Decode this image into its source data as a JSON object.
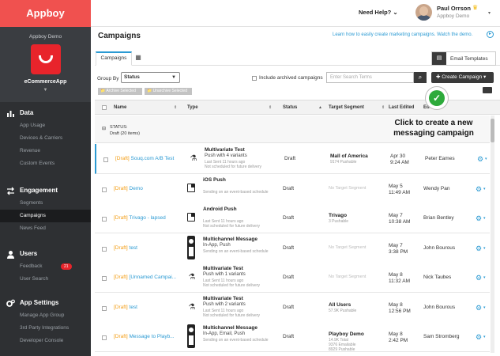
{
  "brand": "Appboy",
  "sidebar": {
    "app_title": "Appboy Demo",
    "app_name": "eCommerceApp",
    "sections": [
      {
        "label": "Data",
        "items": [
          "App Usage",
          "Devices & Carriers",
          "Revenue",
          "Custom Events"
        ]
      },
      {
        "label": "Engagement",
        "items": [
          "Segments",
          "Campaigns",
          "News Feed"
        ]
      },
      {
        "label": "Users",
        "items": [
          "Feedback",
          "User Search"
        ],
        "feedback_badge": "21"
      },
      {
        "label": "App Settings",
        "items": [
          "Manage App Group",
          "3rd Party Integrations",
          "Developer Console"
        ]
      }
    ]
  },
  "topbar": {
    "help": "Need Help? ⌄",
    "user_name": "Paul Orrson",
    "user_org": "Appboy Demo"
  },
  "page": {
    "title": "Campaigns",
    "learn_link": "Learn how to easily create marketing campaigns. Watch the demo.",
    "tabs": [
      "Campaigns"
    ],
    "email_templates": "Email Templates",
    "group_by_label": "Group By",
    "group_by_value": "Status",
    "include_archived": "Include archived campaigns",
    "search_placeholder": "Enter Search Terms",
    "create_button": "✚ Create Campaign ▾",
    "archive_selected": "📁 Archive Selected",
    "unarchive_selected": "📁 Unarchive Selected",
    "callout": "Click to create a new messaging campaign"
  },
  "table": {
    "headers": [
      "Name",
      "Type",
      "Status",
      "Target Segment",
      "Last Edited",
      "Ed"
    ],
    "group": {
      "label": "STATUS:",
      "value": "Draft (20 items)"
    },
    "rows": [
      {
        "name": "Souq.com A/B Test",
        "type": "Multivariate Test",
        "type_sub": "Push with 4 variants",
        "t3": "Last Sent 11 hours ago",
        "t4": "Not scheduled for future delivery",
        "status": "Draft",
        "segment": "Mall of America",
        "segment_sub": "9174 Pushable",
        "segment_sub2": "",
        "segment_sub3": "",
        "d1": "Apr 30",
        "d2": "9:24 AM",
        "editor": "Peter Eames"
      },
      {
        "name": "Demo",
        "type": "iOS Push",
        "type_sub": "",
        "t3": "Sending on an event-based schedule",
        "t4": "",
        "status": "Draft",
        "segment": "",
        "segment_sub": "",
        "segment_sub2": "",
        "segment_sub3": "",
        "noseg": "No Target Segment",
        "d1": "May 5",
        "d2": "11:49 AM",
        "editor": "Wendy Pan"
      },
      {
        "name": "Trivago - lapsed",
        "type": "Android Push",
        "type_sub": "",
        "t3": "Last Sent 11 hours ago",
        "t4": "Not scheduled for future delivery",
        "status": "Draft",
        "segment": "Trivago",
        "segment_sub": "3 Pushable",
        "segment_sub2": "",
        "segment_sub3": "",
        "d1": "May 7",
        "d2": "10:38 AM",
        "editor": "Brian Bentley"
      },
      {
        "name": "test",
        "type": "Multichannel Message",
        "type_sub": "In-App, Push",
        "t3": "Sending on an event-based schedule",
        "t4": "",
        "status": "Draft",
        "segment": "",
        "segment_sub": "",
        "segment_sub2": "",
        "segment_sub3": "",
        "noseg": "No Target Segment",
        "d1": "May 7",
        "d2": "3:38 PM",
        "editor": "John Bourous"
      },
      {
        "name": "[Unnamed Campai...",
        "type": "Multivariate Test",
        "type_sub": "Push with 1 variants",
        "t3": "Last Sent 11 hours ago",
        "t4": "Not scheduled for future delivery",
        "status": "Draft",
        "segment": "",
        "segment_sub": "",
        "segment_sub2": "",
        "segment_sub3": "",
        "noseg": "No Target Segment",
        "d1": "May 8",
        "d2": "11:32 AM",
        "editor": "Nick Taubes"
      },
      {
        "name": "test",
        "type": "Multivariate Test",
        "type_sub": "Push with 2 variants",
        "t3": "Last Sent 11 hours ago",
        "t4": "Not scheduled for future delivery",
        "status": "Draft",
        "segment": "All Users",
        "segment_sub": "57.9K Pushable",
        "segment_sub2": "",
        "segment_sub3": "",
        "d1": "May 8",
        "d2": "12:56 PM",
        "editor": "John Bourous"
      },
      {
        "name": "Message to Playb...",
        "type": "Multichannel Message",
        "type_sub": "In-App, Email, Push",
        "t3": "Sending on an event-based schedule",
        "t4": "",
        "status": "Draft",
        "segment": "Playboy Demo",
        "segment_sub": "14.9K Total",
        "segment_sub2": "9376 Emailable",
        "segment_sub3": "8929 Pushable",
        "d1": "May 8",
        "d2": "2:42 PM",
        "editor": "Sam Stromberg"
      }
    ],
    "draft_tag": "[Draft]"
  },
  "colors": {
    "brand": "#f0514f",
    "accent": "#2b9ad3",
    "draft": "#f39c12",
    "success": "#2daa3b",
    "sidebar": "#2e3033"
  }
}
